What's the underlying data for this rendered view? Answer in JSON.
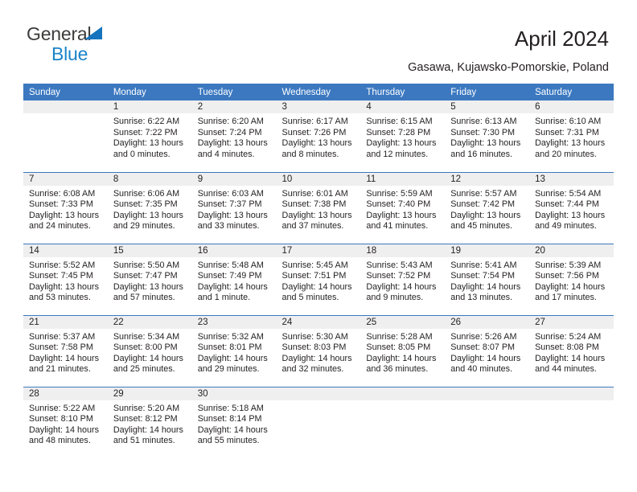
{
  "brand": {
    "name_part1": "General",
    "name_part2": "Blue",
    "accent_color": "#1b84c8",
    "triangle_color": "#1574bd"
  },
  "header": {
    "title": "April 2024",
    "subtitle": "Gasawa, Kujawsko-Pomorskie, Poland",
    "header_bg_color": "#3b78c0",
    "daynum_band_color": "#efefef"
  },
  "calendar": {
    "weekday_headers": [
      "Sunday",
      "Monday",
      "Tuesday",
      "Wednesday",
      "Thursday",
      "Friday",
      "Saturday"
    ],
    "weeks": [
      [
        {
          "day": "",
          "info": ""
        },
        {
          "day": "1",
          "info": "Sunrise: 6:22 AM\nSunset: 7:22 PM\nDaylight: 13 hours\nand 0 minutes."
        },
        {
          "day": "2",
          "info": "Sunrise: 6:20 AM\nSunset: 7:24 PM\nDaylight: 13 hours\nand 4 minutes."
        },
        {
          "day": "3",
          "info": "Sunrise: 6:17 AM\nSunset: 7:26 PM\nDaylight: 13 hours\nand 8 minutes."
        },
        {
          "day": "4",
          "info": "Sunrise: 6:15 AM\nSunset: 7:28 PM\nDaylight: 13 hours\nand 12 minutes."
        },
        {
          "day": "5",
          "info": "Sunrise: 6:13 AM\nSunset: 7:30 PM\nDaylight: 13 hours\nand 16 minutes."
        },
        {
          "day": "6",
          "info": "Sunrise: 6:10 AM\nSunset: 7:31 PM\nDaylight: 13 hours\nand 20 minutes."
        }
      ],
      [
        {
          "day": "7",
          "info": "Sunrise: 6:08 AM\nSunset: 7:33 PM\nDaylight: 13 hours\nand 24 minutes."
        },
        {
          "day": "8",
          "info": "Sunrise: 6:06 AM\nSunset: 7:35 PM\nDaylight: 13 hours\nand 29 minutes."
        },
        {
          "day": "9",
          "info": "Sunrise: 6:03 AM\nSunset: 7:37 PM\nDaylight: 13 hours\nand 33 minutes."
        },
        {
          "day": "10",
          "info": "Sunrise: 6:01 AM\nSunset: 7:38 PM\nDaylight: 13 hours\nand 37 minutes."
        },
        {
          "day": "11",
          "info": "Sunrise: 5:59 AM\nSunset: 7:40 PM\nDaylight: 13 hours\nand 41 minutes."
        },
        {
          "day": "12",
          "info": "Sunrise: 5:57 AM\nSunset: 7:42 PM\nDaylight: 13 hours\nand 45 minutes."
        },
        {
          "day": "13",
          "info": "Sunrise: 5:54 AM\nSunset: 7:44 PM\nDaylight: 13 hours\nand 49 minutes."
        }
      ],
      [
        {
          "day": "14",
          "info": "Sunrise: 5:52 AM\nSunset: 7:45 PM\nDaylight: 13 hours\nand 53 minutes."
        },
        {
          "day": "15",
          "info": "Sunrise: 5:50 AM\nSunset: 7:47 PM\nDaylight: 13 hours\nand 57 minutes."
        },
        {
          "day": "16",
          "info": "Sunrise: 5:48 AM\nSunset: 7:49 PM\nDaylight: 14 hours\nand 1 minute."
        },
        {
          "day": "17",
          "info": "Sunrise: 5:45 AM\nSunset: 7:51 PM\nDaylight: 14 hours\nand 5 minutes."
        },
        {
          "day": "18",
          "info": "Sunrise: 5:43 AM\nSunset: 7:52 PM\nDaylight: 14 hours\nand 9 minutes."
        },
        {
          "day": "19",
          "info": "Sunrise: 5:41 AM\nSunset: 7:54 PM\nDaylight: 14 hours\nand 13 minutes."
        },
        {
          "day": "20",
          "info": "Sunrise: 5:39 AM\nSunset: 7:56 PM\nDaylight: 14 hours\nand 17 minutes."
        }
      ],
      [
        {
          "day": "21",
          "info": "Sunrise: 5:37 AM\nSunset: 7:58 PM\nDaylight: 14 hours\nand 21 minutes."
        },
        {
          "day": "22",
          "info": "Sunrise: 5:34 AM\nSunset: 8:00 PM\nDaylight: 14 hours\nand 25 minutes."
        },
        {
          "day": "23",
          "info": "Sunrise: 5:32 AM\nSunset: 8:01 PM\nDaylight: 14 hours\nand 29 minutes."
        },
        {
          "day": "24",
          "info": "Sunrise: 5:30 AM\nSunset: 8:03 PM\nDaylight: 14 hours\nand 32 minutes."
        },
        {
          "day": "25",
          "info": "Sunrise: 5:28 AM\nSunset: 8:05 PM\nDaylight: 14 hours\nand 36 minutes."
        },
        {
          "day": "26",
          "info": "Sunrise: 5:26 AM\nSunset: 8:07 PM\nDaylight: 14 hours\nand 40 minutes."
        },
        {
          "day": "27",
          "info": "Sunrise: 5:24 AM\nSunset: 8:08 PM\nDaylight: 14 hours\nand 44 minutes."
        }
      ],
      [
        {
          "day": "28",
          "info": "Sunrise: 5:22 AM\nSunset: 8:10 PM\nDaylight: 14 hours\nand 48 minutes."
        },
        {
          "day": "29",
          "info": "Sunrise: 5:20 AM\nSunset: 8:12 PM\nDaylight: 14 hours\nand 51 minutes."
        },
        {
          "day": "30",
          "info": "Sunrise: 5:18 AM\nSunset: 8:14 PM\nDaylight: 14 hours\nand 55 minutes."
        },
        {
          "day": "",
          "info": ""
        },
        {
          "day": "",
          "info": ""
        },
        {
          "day": "",
          "info": ""
        },
        {
          "day": "",
          "info": ""
        }
      ]
    ]
  }
}
